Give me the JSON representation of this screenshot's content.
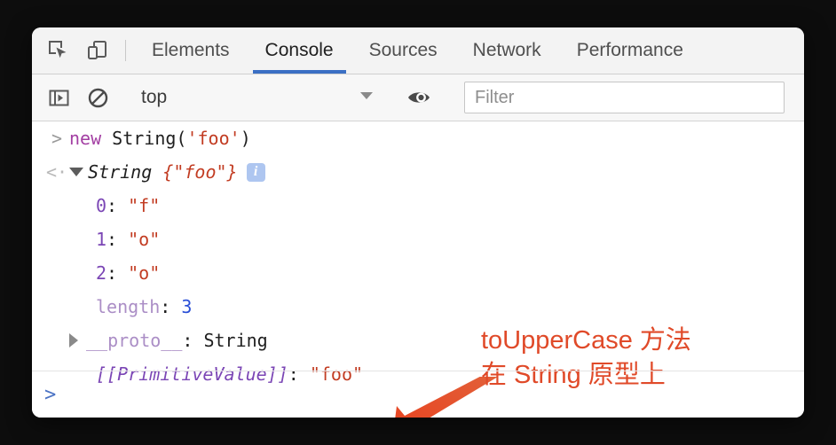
{
  "window": {
    "title": "Chrome DevTools Console"
  },
  "tab_bar": {
    "inspect_icon": "inspect-cursor-icon",
    "device_icon": "device-toolbar-icon",
    "tabs": [
      {
        "label": "Elements",
        "active": false
      },
      {
        "label": "Console",
        "active": true
      },
      {
        "label": "Sources",
        "active": false
      },
      {
        "label": "Network",
        "active": false
      },
      {
        "label": "Performance",
        "active": false
      }
    ]
  },
  "filter_bar": {
    "sidebar_toggle_icon": "console-sidebar-toggle-icon",
    "clear_icon": "clear-console-icon",
    "context_value": "top",
    "caret_icon": "chevron-down-icon",
    "eye_icon": "live-expression-eye-icon",
    "filter_placeholder": "Filter",
    "filter_value": ""
  },
  "console": {
    "input_marker": ">",
    "output_marker": "<·",
    "input_line": {
      "keyword": "new",
      "space": " ",
      "callee": "String(",
      "argument": "'foo'",
      "close": ")"
    },
    "result_line": {
      "constructor": "String",
      "preview": " {\"foo\"}",
      "info_badge": "i"
    },
    "properties": [
      {
        "key": "0",
        "sep": ": ",
        "value": "\"f\"",
        "key_style": "propname",
        "value_style": "string"
      },
      {
        "key": "1",
        "sep": ": ",
        "value": "\"o\"",
        "key_style": "propname",
        "value_style": "string"
      },
      {
        "key": "2",
        "sep": ": ",
        "value": "\"o\"",
        "key_style": "propname",
        "value_style": "string"
      },
      {
        "key": "length",
        "sep": ": ",
        "value": "3",
        "key_style": "dim",
        "value_style": "number"
      },
      {
        "key": "__proto__",
        "sep": ": ",
        "value": "String",
        "key_style": "dim",
        "value_style": "plain"
      },
      {
        "key": "[[PrimitiveValue]]",
        "sep": ": ",
        "value": "\"foo\"",
        "key_style": "propname-italic",
        "value_style": "string"
      }
    ],
    "prompt_chevron": ">"
  },
  "annotation": {
    "text": "toUpperCase 方法\n在 String 原型上",
    "color": "#e04a29",
    "arrow_icon": "arrow-pointing-down-left-icon"
  },
  "colors": {
    "accent_tab_underline": "#3b6fc4",
    "annotation": "#e04a29",
    "keyword": "#a33fa3",
    "string": "#c23c22",
    "property_name": "#7b46b5",
    "property_dim": "#ab8ec6",
    "number": "#2a4fd6",
    "prompt": "#4a72c4",
    "page_background": "#0d0d0d"
  }
}
